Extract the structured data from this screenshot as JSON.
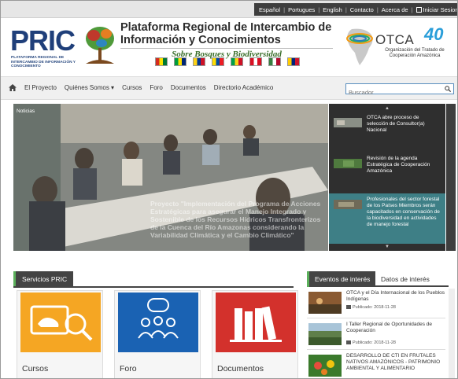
{
  "topbar": {
    "links": [
      "Español",
      "Portugues",
      "English",
      "Contacto",
      "Acerca de",
      "Iniciar Sesion"
    ]
  },
  "header": {
    "pric_logo_text": "PRIC",
    "pric_logo_sub": "PLATAFORMA REGIONAL DE INTERCAMBIO DE INFORMACIÓN Y CONOCIMIENTO",
    "title_line1": "Plataforma Regional de Intercambio de",
    "title_line2": "Información y Conocimientos",
    "subtitle": "Sobre Bosques y Biodiversidad",
    "flag_colors": [
      [
        "#d52b1e",
        "#f9e300",
        "#007934"
      ],
      [
        "#009c3b",
        "#ffdf00",
        "#002776"
      ],
      [
        "#fcd116",
        "#003893",
        "#ce1126"
      ],
      [
        "#ffdd00",
        "#034ea2",
        "#ed1c24"
      ],
      [
        "#009e49",
        "#fcd116",
        "#ce1126"
      ],
      [
        "#d91023",
        "#ffffff",
        "#d91023"
      ],
      [
        "#377e3f",
        "#ffffff",
        "#b40a2d"
      ],
      [
        "#ffcc00",
        "#00247d",
        "#cf142b"
      ]
    ],
    "otca_logo_text": "OTCA",
    "otca_logo_number": "40",
    "otca_sub": "Organización del Tratado de Cooperación Amazónica"
  },
  "nav": {
    "items": [
      "El Proyecto",
      "Quiénes Somos ▾",
      "Cursos",
      "Foro",
      "Documentos",
      "Directorio Académico"
    ],
    "search_placeholder": "Buscador"
  },
  "hero": {
    "label": "Noticias",
    "caption": "Proyecto \"Implementación del Programa de Acciones Estratégicas para asegurar el Manejo Integrado y Sostenible de los Recursos Hídricos Transfronterizos de la Cuenca del Río Amazonas considerando la Variabilidad Climática y el Cambio Climático\""
  },
  "news": [
    {
      "text": "OTCA abre proceso de selección de Consultor(a) Nacional"
    },
    {
      "text": "Revisión de la agenda Estratégica de Cooperación Amazónica"
    },
    {
      "text": "Profesionales del sector forestal de los Países Miembros serán capacitados en conservación de la biodiversidad en actividades de manejo forestal"
    }
  ],
  "services": {
    "tab_label": "Servicios PRIC",
    "cards": [
      {
        "label": "Cursos",
        "color": "#f5a623"
      },
      {
        "label": "Foro",
        "color": "#1a62b3"
      },
      {
        "label": "Documentos",
        "color": "#d3312c"
      }
    ]
  },
  "events": {
    "tab_active": "Eventos de interés",
    "tab_other": "Datos de interés",
    "items": [
      {
        "title": "OTCA y el Día Internacional de los Pueblos Indígenas",
        "date": "Publicado: 2018-11-28"
      },
      {
        "title": "I Taller Regional de Oportunidades de Cooperación",
        "date": "Publicado: 2018-11-28"
      },
      {
        "title": "DESARROLLO DE CTI EN FRUTALES NATIVOS AMAZÓNICOS - PATRIMONIO AMBIENTAL Y ALIMENTARIO",
        "date": ""
      }
    ]
  }
}
